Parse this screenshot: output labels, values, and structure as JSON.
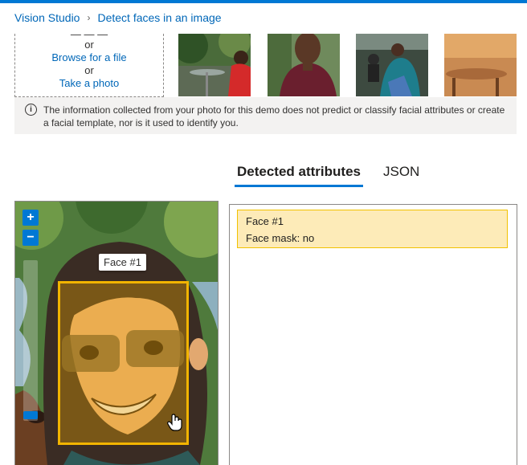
{
  "breadcrumb": {
    "root": "Vision Studio",
    "current": "Detect faces in an image"
  },
  "upload": {
    "or_1": "or",
    "browse": "Browse for a file",
    "or_2": "or",
    "take_photo": "Take a photo"
  },
  "info": {
    "message": "The information collected from your photo for this demo does not predict or classify facial attributes or create a facial template, nor is it used to identify you."
  },
  "tabs": {
    "detected": "Detected attributes",
    "json": "JSON",
    "active": "Detected attributes"
  },
  "viewer": {
    "zoom_in": "+",
    "zoom_out": "−",
    "face_label": "Face #1"
  },
  "results": {
    "faces": [
      {
        "title": "Face #1",
        "mask": "Face mask: no"
      }
    ]
  },
  "colors": {
    "accent": "#0078d4",
    "face_box": "#f2b400",
    "result_bg": "#fdebb8"
  }
}
